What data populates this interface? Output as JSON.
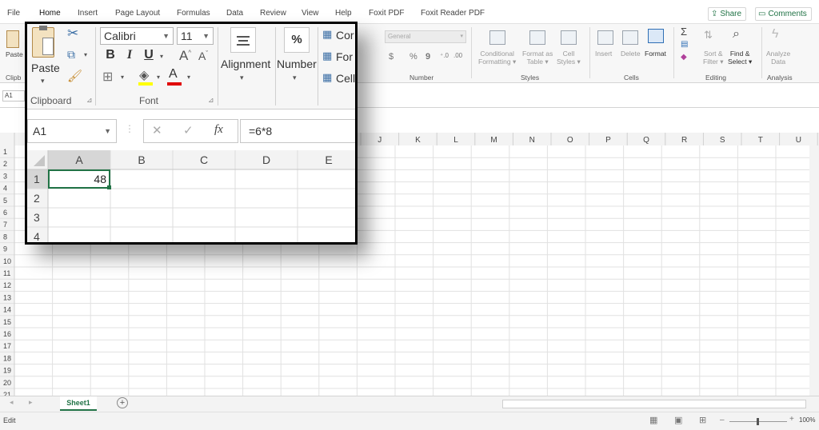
{
  "menu": {
    "items": [
      "File",
      "Home",
      "Insert",
      "Page Layout",
      "Formulas",
      "Data",
      "Review",
      "View",
      "Help",
      "Foxit PDF",
      "Foxit Reader PDF"
    ],
    "share": "Share",
    "comments": "Comments"
  },
  "ribbon": {
    "paste": "Paste",
    "clipboard_short": "Clipb",
    "number_format": "General",
    "number_symbols": [
      "$",
      "%",
      "9"
    ],
    "groups": {
      "number": "Number",
      "styles": "Styles",
      "cells": "Cells",
      "editing": "Editing",
      "analysis": "Analysis"
    },
    "styles_buttons": [
      "Conditional",
      "Formatting",
      "Format as",
      "Table",
      "Cell",
      "Styles"
    ],
    "cells_buttons": [
      "Insert",
      "Delete",
      "Format"
    ],
    "editing_buttons": [
      "Sort &",
      "Filter",
      "Find &",
      "Select"
    ],
    "analysis_buttons": [
      "Analyze",
      "Data"
    ],
    "sigma": "Σ"
  },
  "formula_bar": {
    "name_box": "A1"
  },
  "grid": {
    "col_headers": [
      "J",
      "K",
      "L",
      "M",
      "N",
      "O",
      "P",
      "Q",
      "R",
      "S",
      "T",
      "U"
    ],
    "row_headers": [
      "1",
      "2",
      "3",
      "4",
      "5",
      "6",
      "7",
      "8",
      "9",
      "10",
      "11",
      "12",
      "13",
      "14",
      "15",
      "16",
      "17",
      "18",
      "19",
      "20",
      "21"
    ]
  },
  "sheets": {
    "active": "Sheet1",
    "add": "+"
  },
  "status": {
    "mode": "Edit",
    "zoom": "100%"
  },
  "zoom_callout": {
    "clipboard": {
      "paste": "Paste",
      "label": "Clipboard"
    },
    "font": {
      "name": "Calibri",
      "size": "11",
      "label": "Font",
      "bold": "B",
      "italic": "I",
      "underline": "U"
    },
    "alignment": {
      "label": "Alignment"
    },
    "number": {
      "label": "Number",
      "symbol": "%"
    },
    "styles_partial": [
      "Cor",
      "For",
      "Cell"
    ],
    "name_box": "A1",
    "formula": "=6*8",
    "fx": "fx",
    "col_headers": [
      "A",
      "B",
      "C",
      "D",
      "E"
    ],
    "row_headers": [
      "1",
      "2",
      "3",
      "4"
    ],
    "cell_a1": "48"
  }
}
